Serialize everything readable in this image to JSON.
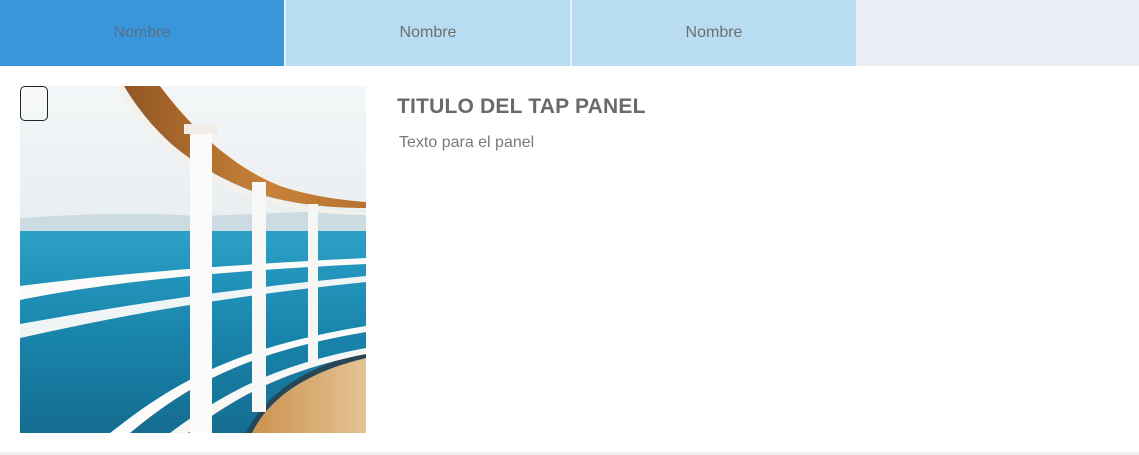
{
  "tabs": [
    {
      "label": "Nombre",
      "state": "active"
    },
    {
      "label": "Nombre",
      "state": "inactive"
    },
    {
      "label": "Nombre",
      "state": "inactive"
    }
  ],
  "panel": {
    "title": "TITULO DEL TAP PANEL",
    "text": "Texto para el panel"
  },
  "colors": {
    "tab_active": "#3a96da",
    "tab_inactive": "#b8dcf2",
    "tabbar_bg": "#eaeef4"
  }
}
